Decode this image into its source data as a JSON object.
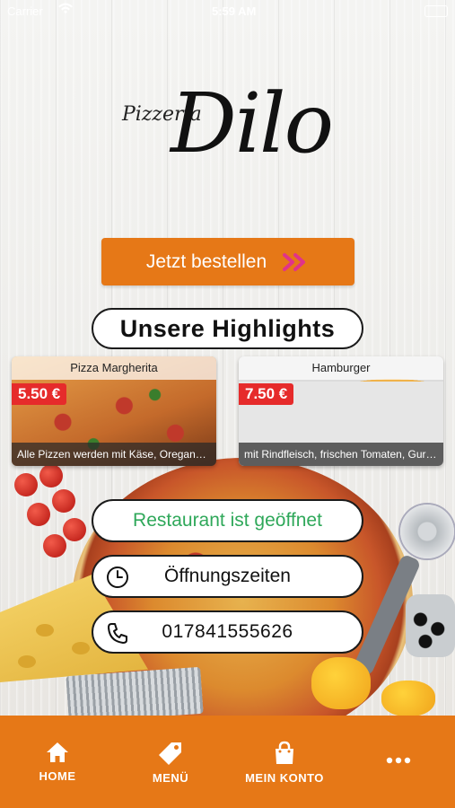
{
  "status_bar": {
    "carrier": "Carrier",
    "time": "5:59 AM"
  },
  "logo": {
    "word_small": "Pizzeria",
    "word_big": "Dilo"
  },
  "order_button": {
    "label": "Jetzt bestellen",
    "icon": "double-chevron-right-icon"
  },
  "highlights": {
    "title": "Unsere Highlights",
    "items": [
      {
        "name": "Pizza Margherita",
        "price": "5.50 €",
        "description": "Alle Pizzen werden mit Käse, Oregano u..."
      },
      {
        "name": "Hamburger",
        "price": "7.50 €",
        "description": "mit Rindfleisch, frischen Tomaten, Gurk..."
      }
    ]
  },
  "info": {
    "status": "Restaurant ist geöffnet",
    "hours_label": "Öffnungszeiten",
    "phone": "017841555626"
  },
  "tabbar": {
    "items": [
      {
        "label": "HOME",
        "icon": "home-icon"
      },
      {
        "label": "MENÜ",
        "icon": "tag-icon"
      },
      {
        "label": "MEIN KONTO",
        "icon": "shopping-bag-icon"
      },
      {
        "label": "",
        "icon": "more-dots-icon"
      }
    ]
  },
  "colors": {
    "accent": "#e67817",
    "price_badge": "#e62b2b",
    "open_status": "#2fa85a"
  }
}
